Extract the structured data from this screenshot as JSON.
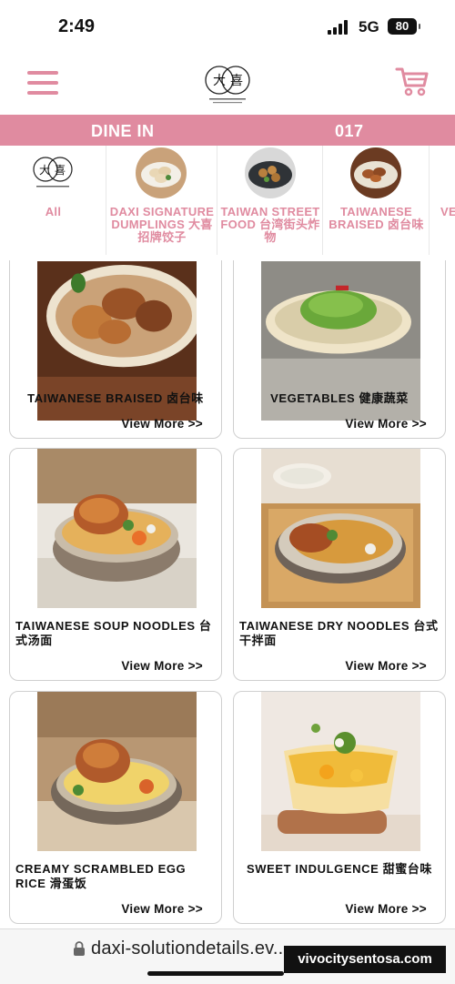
{
  "status_bar": {
    "time": "2:49",
    "network": "5G",
    "battery": "80"
  },
  "header": {
    "menu_icon": "hamburger-icon",
    "cart_icon": "cart-icon",
    "brand_color": "#e08ba0"
  },
  "dine_bar": {
    "mode": "DINE IN",
    "table": "017"
  },
  "categories": [
    {
      "label": "All"
    },
    {
      "label": "DAXI SIGNATURE DUMPLINGS 大喜招牌饺子"
    },
    {
      "label": "TAIWAN STREET FOOD 台湾街头炸物"
    },
    {
      "label": "TAIWANESE BRAISED 卤台味"
    },
    {
      "label": "VE"
    }
  ],
  "menu_items": [
    {
      "title": "TAIWANESE BRAISED 卤台味",
      "more": "View More >>"
    },
    {
      "title": "VEGETABLES 健康蔬菜",
      "more": "View More >>"
    },
    {
      "title": "TAIWANESE SOUP NOODLES 台式汤面",
      "more": "View More >>"
    },
    {
      "title": "TAIWANESE DRY NOODLES 台式干拌面",
      "more": "View More >>"
    },
    {
      "title": "CREAMY SCRAMBLED EGG RICE 滑蛋饭",
      "more": "View More >>"
    },
    {
      "title": "SWEET INDULGENCE 甜蜜台味",
      "more": "View More >>"
    }
  ],
  "browser": {
    "url": "daxi-solutiondetails.ev...",
    "lock_icon": "lock-icon"
  },
  "watermark": "vivocitysentosa.com"
}
